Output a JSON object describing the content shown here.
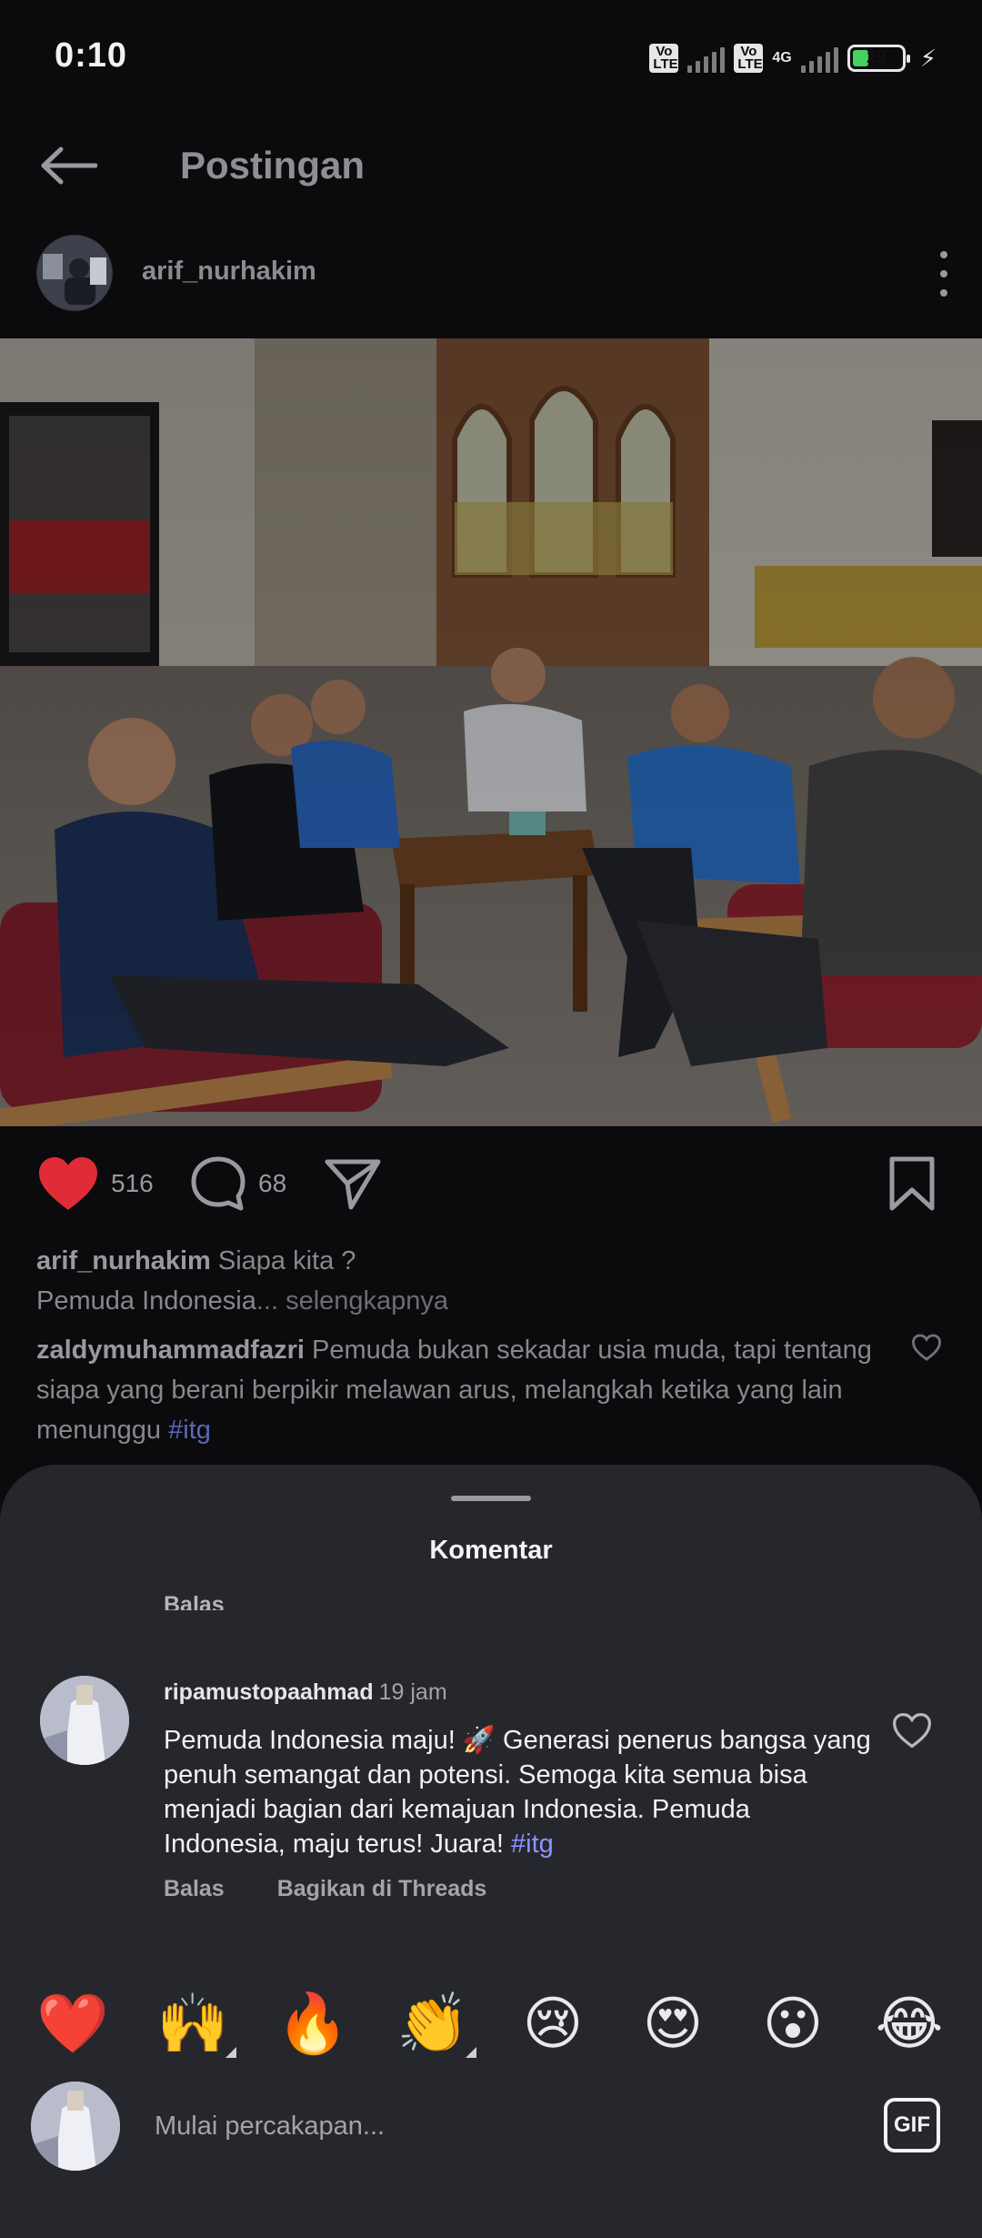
{
  "status_bar": {
    "time": "0:10",
    "volte1": "Vo LTE",
    "volte2": "Vo LTE",
    "network": "4G",
    "battery": "29"
  },
  "header": {
    "title": "Postingan"
  },
  "post": {
    "author": "arif_nurhakim",
    "likes": "516",
    "comments": "68",
    "caption_user": "arif_nurhakim",
    "caption_text": "Siapa kita ?",
    "caption_line2": "Pemuda Indonesia",
    "caption_more": "... selengkapnya",
    "top_comment": {
      "user": "zaldymuhammadfazri",
      "text": "Pemuda bukan sekadar usia muda, tapi tentang siapa yang berani berpikir melawan arus, melangkah ketika yang lain menunggu",
      "tag": "#itg"
    }
  },
  "sheet": {
    "title": "Komentar",
    "cut_reply": "Balas",
    "comment": {
      "user": "ripamustopaahmad",
      "time": "19 jam",
      "text": "Pemuda Indonesia maju! 🚀 Generasi penerus bangsa yang penuh semangat dan potensi. Semoga kita semua bisa menjadi bagian dari kemajuan Indonesia. Pemuda Indonesia, maju terus!  Juara!",
      "tag": "#itg",
      "reply_label": "Balas",
      "share_label": "Bagikan di Threads"
    },
    "emojis": [
      "❤️",
      "🙌",
      "🔥",
      "👏",
      "😢",
      "😍",
      "😮",
      "😂"
    ],
    "input": {
      "placeholder": "Mulai percakapan...",
      "gif_label": "GIF"
    }
  },
  "colors": {
    "like_red": "#e02c36",
    "background": "#0b0b0d",
    "sheet": "#25272c",
    "hashtag": "#8c93ff"
  }
}
